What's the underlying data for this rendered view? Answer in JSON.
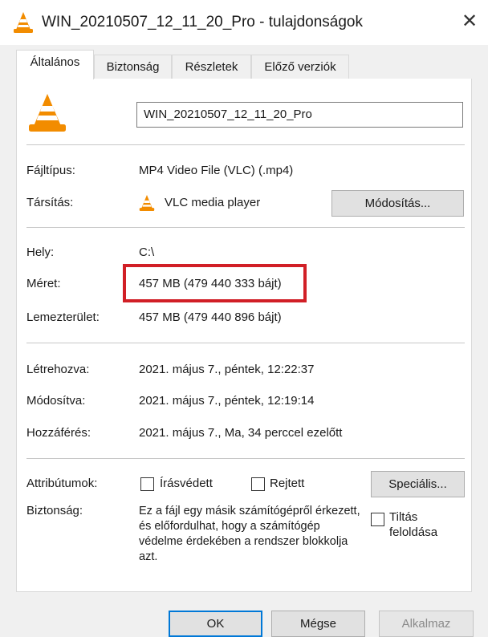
{
  "window": {
    "title": "WIN_20210507_12_11_20_Pro - tulajdonságok",
    "app_icon": "vlc-cone-icon",
    "close_glyph": "✕"
  },
  "tabs": [
    {
      "label": "Általános",
      "active": true
    },
    {
      "label": "Biztonság",
      "active": false
    },
    {
      "label": "Részletek",
      "active": false
    },
    {
      "label": "Előző verziók",
      "active": false
    }
  ],
  "general": {
    "file_name": "WIN_20210507_12_11_20_Pro",
    "file_type_label": "Fájltípus:",
    "file_type_value": "MP4 Video File (VLC) (.mp4)",
    "opens_with_label": "Társítás:",
    "opens_with_value": "VLC media player",
    "change_button": "Módosítás...",
    "location_label": "Hely:",
    "location_value": "C:\\",
    "size_label": "Méret:",
    "size_value": "457 MB (479 440 333 bájt)",
    "size_on_disk_label": "Lemezterület:",
    "size_on_disk_value": "457 MB (479 440 896 bájt)",
    "created_label": "Létrehozva:",
    "created_value": "2021. május 7., péntek, 12:22:37",
    "modified_label": "Módosítva:",
    "modified_value": "2021. május 7., péntek, 12:19:14",
    "accessed_label": "Hozzáférés:",
    "accessed_value": "2021. május 7., Ma, 34 perccel ezelőtt",
    "attributes_label": "Attribútumok:",
    "readonly_label": "Írásvédett",
    "readonly_checked": false,
    "hidden_label": "Rejtett",
    "hidden_checked": false,
    "advanced_button": "Speciális...",
    "security_label": "Biztonság:",
    "security_text": "Ez a fájl egy másik számítógépről érkezett, és előfordulhat, hogy a számítógép védelme érdekében a rendszer blokkolja azt.",
    "unblock_label_line1": "Tiltás",
    "unblock_label_line2": "feloldása",
    "unblock_checked": false,
    "highlight_color": "#d11f26"
  },
  "footer": {
    "ok_button": "OK",
    "cancel_button": "Mégse",
    "apply_button": "Alkalmaz"
  }
}
